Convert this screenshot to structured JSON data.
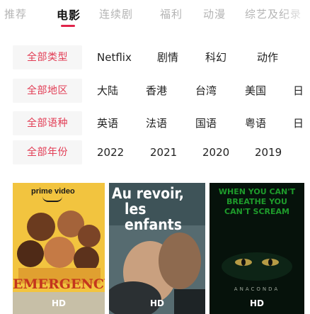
{
  "tabs": [
    {
      "label": "推荐",
      "active": false
    },
    {
      "label": "电影",
      "active": true
    },
    {
      "label": "连续剧",
      "active": false
    },
    {
      "label": "福利",
      "active": false
    },
    {
      "label": "动漫",
      "active": false
    },
    {
      "label": "综艺及纪录",
      "active": false
    }
  ],
  "filters": {
    "type": {
      "label": "全部类型",
      "options": [
        "Netflix",
        "剧情",
        "科幻",
        "动作"
      ]
    },
    "region": {
      "label": "全部地区",
      "options": [
        "大陆",
        "香港",
        "台湾",
        "美国",
        "日"
      ]
    },
    "language": {
      "label": "全部语种",
      "options": [
        "英语",
        "法语",
        "国语",
        "粤语",
        "日"
      ]
    },
    "year": {
      "label": "全部年份",
      "options": [
        "2022",
        "2021",
        "2020",
        "2019"
      ]
    }
  },
  "posters": [
    {
      "brand": "prime video",
      "title": "EMERGENCY",
      "badge": "HD"
    },
    {
      "title_line1": "Au revoir,",
      "title_line2": "les enfants",
      "badge": "HD"
    },
    {
      "tagline": "WHEN YOU CAN'T BREATHE YOU CAN'T SCREAM",
      "title": "ANACONDA",
      "badge": "HD"
    }
  ],
  "colors": {
    "accent": "#e0244a",
    "chip_text": "#e23d55",
    "chip_bg": "#f6f6f6"
  }
}
